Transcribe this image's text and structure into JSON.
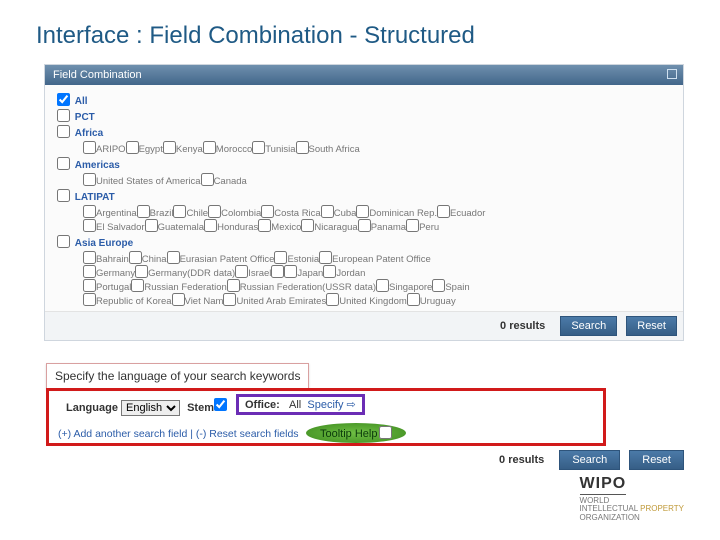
{
  "title": "Interface : Field Combination - Structured",
  "panel": {
    "header": "Field Combination"
  },
  "regions": {
    "all": "All",
    "pct": "PCT",
    "africa": "Africa",
    "africa_countries": [
      "ARIPO",
      "Egypt",
      "Kenya",
      "Morocco",
      "Tunisia",
      "South Africa"
    ],
    "americas": "Americas",
    "americas_countries": [
      "United States of America",
      "Canada"
    ],
    "latipat": "LATIPAT",
    "latipat_countries_row1": [
      "Argentina",
      "Brazil",
      "Chile",
      "Colombia",
      "Costa Rica",
      "Cuba",
      "Dominican Rep.",
      "Ecuador"
    ],
    "latipat_countries_row2": [
      "El Salvador",
      "Guatemala",
      "Honduras",
      "Mexico",
      "Nicaragua",
      "Panama",
      "Peru"
    ],
    "asia_europe": "Asia Europe",
    "asia_europe_row1": [
      "Bahrain",
      "China",
      "Eurasian Patent Office",
      "Estonia",
      "European Patent Office"
    ],
    "asia_europe_row2": [
      "Germany",
      "Germany(DDR data)",
      "Israel",
      "",
      "Japan",
      "Jordan"
    ],
    "asia_europe_row3": [
      "Portugal",
      "Russian Federation",
      "Russian Federation(USSR data)",
      "Singapore",
      "Spain"
    ],
    "asia_europe_row4": [
      "Republic of Korea",
      "Viet Nam",
      "United Arab Emirates",
      "United Kingdom",
      "Uruguay"
    ]
  },
  "results1": {
    "count": "0 results",
    "search": "Search",
    "reset": "Reset"
  },
  "callout": "Specify the language of your search keywords",
  "lang": {
    "label": "Language",
    "value": "English",
    "stem_label": "Stem",
    "office_label": "Office:",
    "office_value": "All",
    "specify": "Specify ⇨"
  },
  "addline": "(+) Add another search field | (-) Reset search fields",
  "tooltip": "Tooltip Help",
  "results2": {
    "count": "0 results",
    "search": "Search",
    "reset": "Reset"
  },
  "wipo": {
    "mark": "WIPO",
    "l1": "WORLD",
    "l2a": "INTELLECTUAL ",
    "l2b": "PROPERTY",
    "l3": "ORGANIZATION"
  }
}
